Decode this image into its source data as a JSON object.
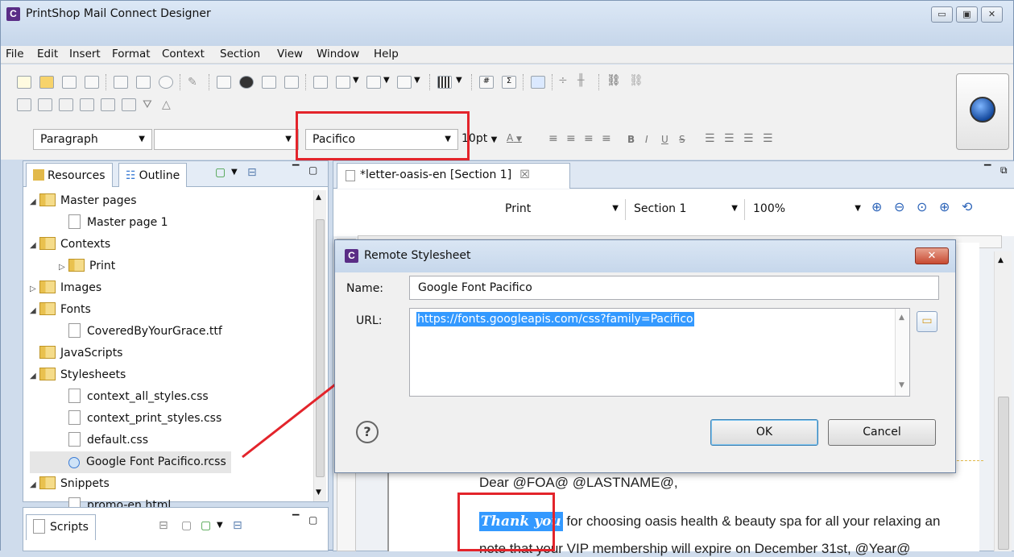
{
  "app": {
    "title": "PrintShop Mail Connect Designer"
  },
  "menu": [
    "File",
    "Edit",
    "Insert",
    "Format",
    "Context",
    "Section",
    "View",
    "Window",
    "Help"
  ],
  "format_bar": {
    "paragraph": "Paragraph",
    "class_value": "",
    "font": "Pacifico",
    "size": "10pt",
    "color_label": "A"
  },
  "left_tabs": {
    "resources": "Resources",
    "outline": "Outline"
  },
  "tree": [
    {
      "label": "Master pages",
      "type": "folder",
      "level": 0,
      "state": "open"
    },
    {
      "label": "Master page 1",
      "type": "file",
      "level": 1
    },
    {
      "label": "Contexts",
      "type": "folder",
      "level": 0,
      "state": "open"
    },
    {
      "label": "Print",
      "type": "folder",
      "level": 1,
      "state": "closed"
    },
    {
      "label": "Images",
      "type": "folder",
      "level": 0,
      "state": "closed"
    },
    {
      "label": "Fonts",
      "type": "folder",
      "level": 0,
      "state": "open"
    },
    {
      "label": "CoveredByYourGrace.ttf",
      "type": "file",
      "level": 1
    },
    {
      "label": "JavaScripts",
      "type": "folder",
      "level": 0,
      "state": "leaf"
    },
    {
      "label": "Stylesheets",
      "type": "folder",
      "level": 0,
      "state": "open"
    },
    {
      "label": "context_all_styles.css",
      "type": "file",
      "level": 1
    },
    {
      "label": "context_print_styles.css",
      "type": "file",
      "level": 1
    },
    {
      "label": "default.css",
      "type": "file",
      "level": 1
    },
    {
      "label": "Google Font Pacifico.rcss",
      "type": "file",
      "level": 1,
      "selected": true
    },
    {
      "label": "Snippets",
      "type": "folder",
      "level": 0,
      "state": "open"
    },
    {
      "label": "promo-en.html",
      "type": "file",
      "level": 1
    }
  ],
  "scripts_tab": "Scripts",
  "editor": {
    "tab": "*letter-oasis-en [Section 1]",
    "context": "Print",
    "section": "Section 1",
    "zoom": "100%"
  },
  "dialog": {
    "title": "Remote Stylesheet",
    "name_label": "Name:",
    "name_value": "Google Font Pacifico",
    "url_label": "URL:",
    "url_value": "https://fonts.googleapis.com/css?family=Pacifico",
    "ok": "OK",
    "cancel": "Cancel",
    "help": "?"
  },
  "document": {
    "salutation": "Dear @FOA@ @LASTNAME@,",
    "thank_you": "Thank you",
    "line1_rest": "for choosing oasis health & beauty spa for all your relaxing an",
    "line2": "note that your VIP membership will expire on December 31st, @Year@"
  },
  "colors": {
    "highlight": "#3399ff",
    "annotation": "#e3242b"
  }
}
